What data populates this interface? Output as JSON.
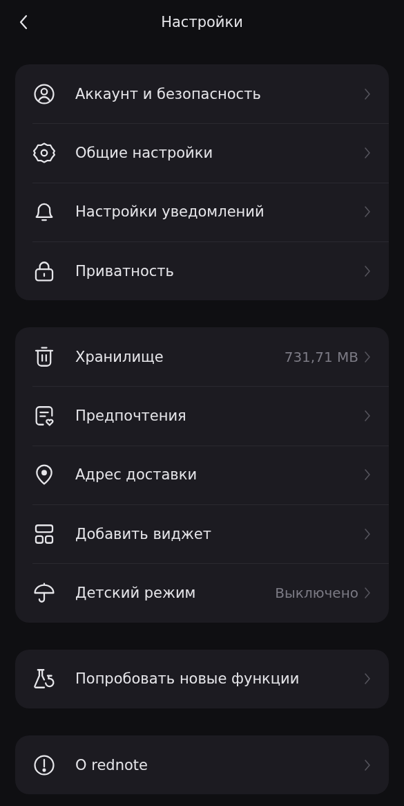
{
  "header": {
    "title": "Настройки"
  },
  "groups": [
    {
      "items": [
        {
          "label": "Аккаунт и безопасность"
        },
        {
          "label": "Общие настройки"
        },
        {
          "label": "Настройки уведомлений"
        },
        {
          "label": "Приватность"
        }
      ]
    },
    {
      "items": [
        {
          "label": "Хранилище",
          "value": "731,71 MB"
        },
        {
          "label": "Предпочтения"
        },
        {
          "label": "Адрес доставки"
        },
        {
          "label": "Добавить виджет"
        },
        {
          "label": "Детский режим",
          "value": "Выключено"
        }
      ]
    },
    {
      "items": [
        {
          "label": "Попробовать новые функции"
        }
      ]
    },
    {
      "items": [
        {
          "label": "О rednote"
        }
      ]
    }
  ]
}
